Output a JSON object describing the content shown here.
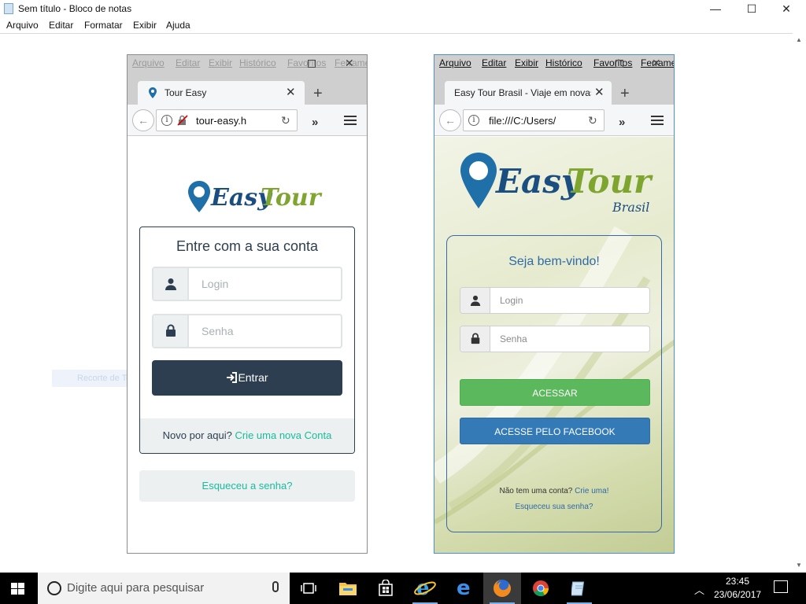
{
  "notepad": {
    "title": "Sem título - Bloco de notas",
    "menu": [
      "Arquivo",
      "Editar",
      "Formatar",
      "Exibir",
      "Ajuda"
    ],
    "controls": {
      "minimize": "—",
      "maximize": "☐",
      "close": "✕"
    }
  },
  "ghost_text": "Recorte de Tela Cheia",
  "left_browser": {
    "menu": [
      "Arquivo",
      "Editar",
      "Exibir",
      "Histórico",
      "Favoritos",
      "Ferrame"
    ],
    "tab_title": "Tour Easy",
    "url": "tour-easy.h",
    "logo_easy": "Easy",
    "logo_tour": "Tour",
    "card_title": "Entre com a sua conta",
    "login_placeholder": "Login",
    "password_placeholder": "Senha",
    "submit_label": "Entrar",
    "footer_text": "Novo por aqui?",
    "footer_link": "Crie uma nova Conta",
    "forgot_label": "Esqueceu a senha?"
  },
  "right_browser": {
    "menu": [
      "Arquivo",
      "Editar",
      "Exibir",
      "Histórico",
      "Favoritos",
      "Ferrame"
    ],
    "tab_title": "Easy Tour Brasil - Viaje em novas",
    "url": "file:///C:/Users/",
    "logo_easy": "Easy",
    "logo_tour": "Tour",
    "logo_sub": "Brasil",
    "welcome": "Seja bem-vindo!",
    "login_placeholder": "Login",
    "password_placeholder": "Senha",
    "submit_label": "ACESSAR",
    "facebook_label": "ACESSE PELO FACEBOOK",
    "no_account_text": "Não tem uma conta?",
    "create_link": "Crie uma!",
    "forgot_link": "Esqueceu sua senha?"
  },
  "taskbar": {
    "search_placeholder": "Digite aqui para pesquisar",
    "time": "23:45",
    "date": "23/06/2017"
  },
  "colors": {
    "left_dark": "#2c3e50",
    "left_link": "#18bc9c",
    "right_blue": "#2f6aa8",
    "right_green": "#5cb85c",
    "right_facebook": "#337ab7"
  }
}
